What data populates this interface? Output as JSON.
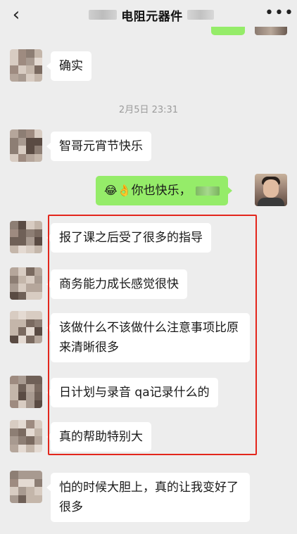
{
  "header": {
    "back_icon": "chevron-left-icon",
    "title": "电阻元器件",
    "more_icon": "ellipsis-icon"
  },
  "messages": [
    {
      "text": "确实"
    },
    {
      "timestamp": "2月5日 23:31"
    },
    {
      "text": "智哥元宵节快乐"
    },
    {
      "text": "你也快乐，",
      "emoji": "😂👌"
    },
    {
      "text": "报了课之后受了很多的指导"
    },
    {
      "text": "商务能力成长感觉很快"
    },
    {
      "text": "该做什么不该做什么注意事项比原来清晰很多"
    },
    {
      "text": "日计划与录音 qa记录什么的"
    },
    {
      "text": "真的帮助特别大"
    },
    {
      "text": "怕的时候大胆上，真的让我变好了很多"
    }
  ],
  "colors": {
    "background": "#ededed",
    "incoming_bubble": "#ffffff",
    "outgoing_bubble": "#95ec69",
    "highlight_border": "#e3261c",
    "timestamp": "#9b9b9b"
  }
}
